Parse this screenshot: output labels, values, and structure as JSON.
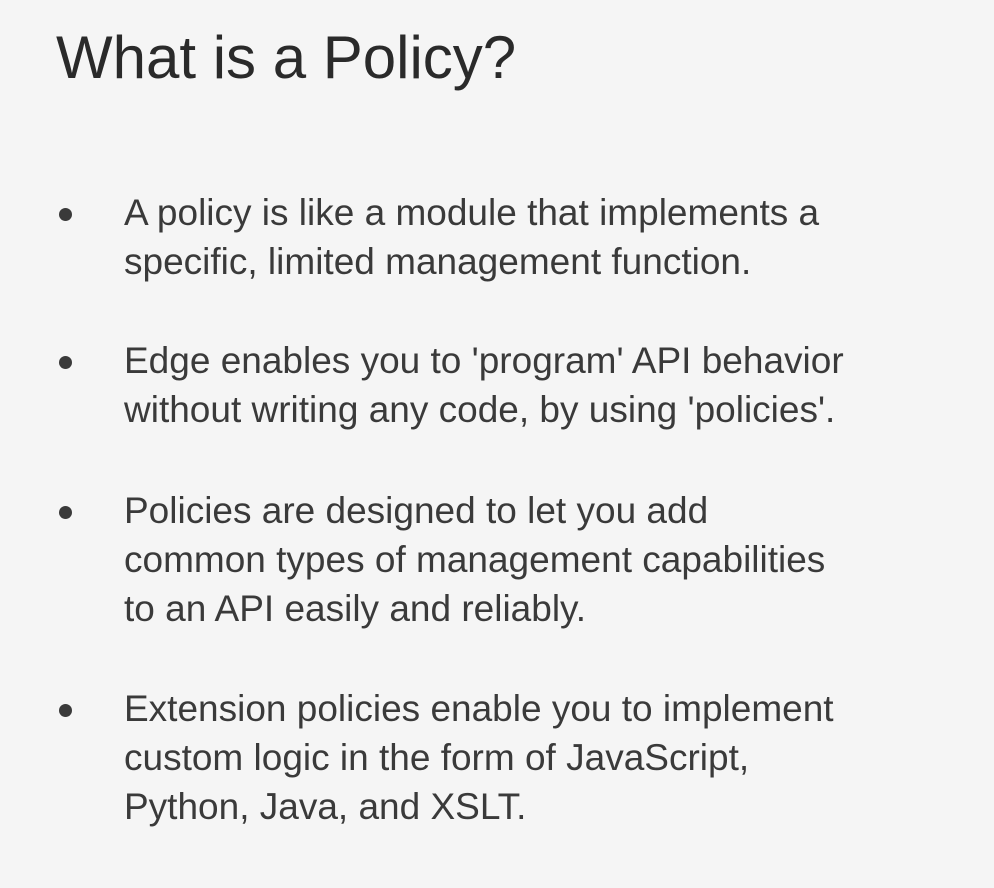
{
  "slide": {
    "title": "What is a Policy?",
    "bullets": [
      "A policy is like a module that implements a\nspecific, limited management function.",
      "Edge enables you to 'program' API behavior\nwithout writing any code, by using 'policies'.",
      "Policies are designed to let you add\ncommon types of management capabilities\nto an API easily and reliably.",
      "Extension policies enable you to implement\ncustom logic in the form of JavaScript,\nPython, Java, and XSLT."
    ]
  }
}
